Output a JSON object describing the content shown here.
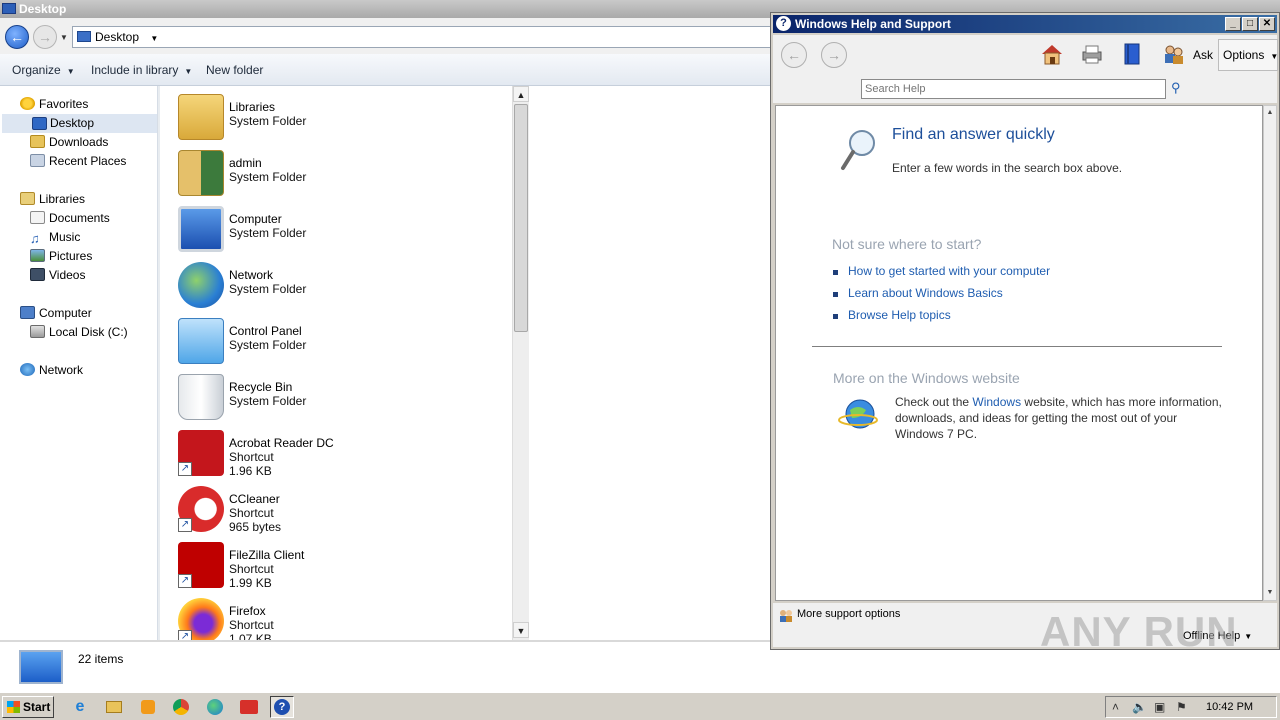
{
  "explorer": {
    "title": "Desktop",
    "address": "Desktop",
    "toolbar": {
      "organize": "Organize",
      "include_in_library": "Include in library",
      "new_folder": "New folder"
    },
    "nav": {
      "favorites": "Favorites",
      "desktop": "Desktop",
      "downloads": "Downloads",
      "recent_places": "Recent Places",
      "libraries": "Libraries",
      "documents": "Documents",
      "music": "Music",
      "pictures": "Pictures",
      "videos": "Videos",
      "computer": "Computer",
      "local_disk": "Local Disk (C:)",
      "network": "Network"
    },
    "files": [
      {
        "name": "Libraries",
        "type": "System Folder",
        "size": ""
      },
      {
        "name": "admin",
        "type": "System Folder",
        "size": ""
      },
      {
        "name": "Computer",
        "type": "System Folder",
        "size": ""
      },
      {
        "name": "Network",
        "type": "System Folder",
        "size": ""
      },
      {
        "name": "Control Panel",
        "type": "System Folder",
        "size": ""
      },
      {
        "name": "Recycle Bin",
        "type": "System Folder",
        "size": ""
      },
      {
        "name": "Acrobat Reader DC",
        "type": "Shortcut",
        "size": "1.96 KB"
      },
      {
        "name": "CCleaner",
        "type": "Shortcut",
        "size": "965 bytes"
      },
      {
        "name": "FileZilla Client",
        "type": "Shortcut",
        "size": "1.99 KB"
      },
      {
        "name": "Firefox",
        "type": "Shortcut",
        "size": "1.07 KB"
      }
    ],
    "status": {
      "item_count": "22 items"
    }
  },
  "help": {
    "title": "Windows Help and Support",
    "toolbar": {
      "ask": "Ask",
      "options": "Options"
    },
    "search_placeholder": "Search Help",
    "find_title": "Find an answer quickly",
    "find_sub": "Enter a few words in the search box above.",
    "not_sure": "Not sure where to start?",
    "links": [
      "How to get started with your computer",
      "Learn about Windows Basics",
      "Browse Help topics"
    ],
    "more_title": "More on the Windows website",
    "more_text_pre": "Check out the ",
    "more_text_link": "Windows",
    "more_text_post": " website, which has more information, downloads, and ideas for getting the most out of your Windows 7 PC.",
    "more_support": "More support options",
    "offline_help": "Offline Help"
  },
  "watermark": "ANY RUN",
  "taskbar": {
    "start": "Start",
    "clock": "10:42 PM"
  }
}
